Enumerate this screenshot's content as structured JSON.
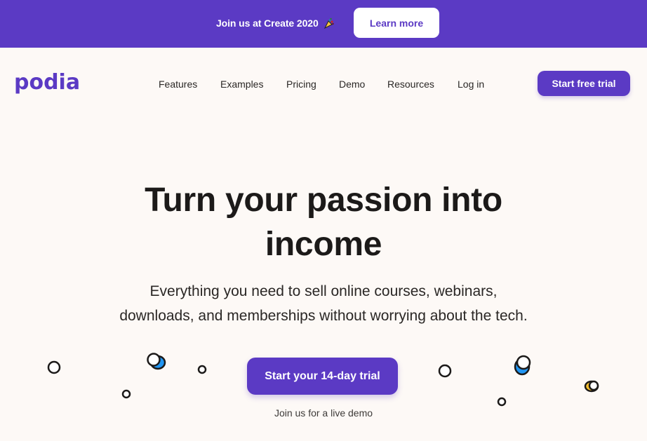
{
  "banner": {
    "text": "Join us at Create 2020",
    "icon": "party-popper-icon",
    "button_label": "Learn more"
  },
  "header": {
    "logo": "podia",
    "nav": [
      {
        "label": "Features"
      },
      {
        "label": "Examples"
      },
      {
        "label": "Pricing"
      },
      {
        "label": "Demo"
      },
      {
        "label": "Resources"
      },
      {
        "label": "Log in"
      }
    ],
    "cta_label": "Start free trial"
  },
  "hero": {
    "title_line1": "Turn your passion into",
    "title_line2": "income",
    "subtitle_line1": "Everything you need to sell online courses, webinars,",
    "subtitle_line2": "downloads, and memberships without worrying about the tech.",
    "cta_label": "Start your 14-day trial",
    "secondary_link": "Join us for a live demo"
  },
  "colors": {
    "brand": "#5b3ac4",
    "background": "#fdf9f6",
    "text": "#1c1a19",
    "accent_blue": "#2196f3",
    "accent_yellow": "#fbc02d"
  }
}
